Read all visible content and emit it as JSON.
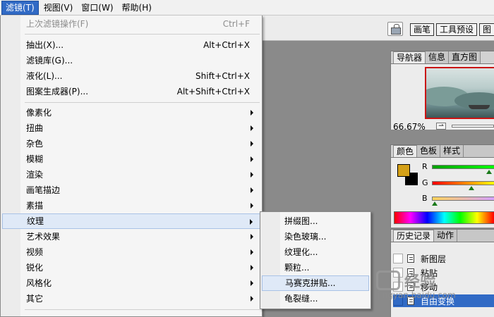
{
  "menubar": {
    "items": [
      {
        "label": "滤镜(T)",
        "active": true
      },
      {
        "label": "视图(V)",
        "active": false
      },
      {
        "label": "窗口(W)",
        "active": false
      },
      {
        "label": "帮助(H)",
        "active": false
      }
    ]
  },
  "options": {
    "well_tabs": [
      "画笔",
      "工具预设",
      "图"
    ]
  },
  "filter_menu": {
    "last_filter": {
      "label": "上次滤镜操作(F)",
      "shortcut": "Ctrl+F"
    },
    "extract": {
      "label": "抽出(X)...",
      "shortcut": "Alt+Ctrl+X"
    },
    "gallery": {
      "label": "滤镜库(G)..."
    },
    "liquify": {
      "label": "液化(L)...",
      "shortcut": "Shift+Ctrl+X"
    },
    "pattern_maker": {
      "label": "图案生成器(P)...",
      "shortcut": "Alt+Shift+Ctrl+X"
    },
    "groups": [
      {
        "label": "像素化"
      },
      {
        "label": "扭曲"
      },
      {
        "label": "杂色"
      },
      {
        "label": "模糊"
      },
      {
        "label": "渲染"
      },
      {
        "label": "画笔描边"
      },
      {
        "label": "素描"
      },
      {
        "label": "纹理"
      },
      {
        "label": "艺术效果"
      },
      {
        "label": "视频"
      },
      {
        "label": "锐化"
      },
      {
        "label": "风格化"
      },
      {
        "label": "其它"
      }
    ]
  },
  "texture_submenu": {
    "items": [
      {
        "label": "拼缀图..."
      },
      {
        "label": "染色玻璃..."
      },
      {
        "label": "纹理化..."
      },
      {
        "label": "颗粒..."
      },
      {
        "label": "马赛克拼贴..."
      },
      {
        "label": "龟裂缝..."
      }
    ]
  },
  "navigator": {
    "tabs": [
      "导航器",
      "信息",
      "直方图"
    ],
    "zoom": "66.67%"
  },
  "color_palette": {
    "tabs": [
      "颜色",
      "色板",
      "样式"
    ],
    "channels": [
      {
        "label": "R",
        "fraction": 0.9,
        "bar": [
          "#00a000",
          "#00ff00"
        ]
      },
      {
        "label": "G",
        "fraction": 0.62,
        "bar": [
          "#ff0000",
          "#ffff00"
        ]
      },
      {
        "label": "B",
        "fraction": 0.04,
        "bar": [
          "#ffd45a",
          "#d4a0ff"
        ]
      }
    ],
    "foreground": "#d4a017",
    "background": "#000000"
  },
  "history": {
    "tabs": [
      "历史记录",
      "动作"
    ],
    "steps": [
      {
        "label": "新图层"
      },
      {
        "label": "粘贴"
      },
      {
        "label": "移动"
      },
      {
        "label": "自由变换"
      }
    ]
  },
  "watermark": {
    "text": "经验",
    "url": "jingyan.baidu.com"
  }
}
